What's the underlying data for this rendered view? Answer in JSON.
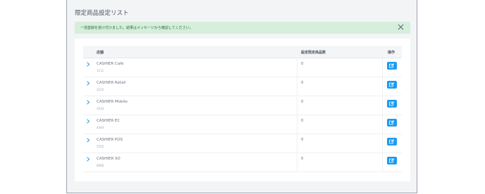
{
  "page": {
    "title": "限定商品設定リスト"
  },
  "alert": {
    "message": "一括登録を受け付けました。結果はメッセージから確認してください。"
  },
  "table": {
    "columns": [
      "店舗",
      "設定限定商品数",
      "操作"
    ],
    "rows": [
      {
        "name": "CASHIER Cafe",
        "code": "1111",
        "count": "0"
      },
      {
        "name": "CASHIER Retail",
        "code": "2222",
        "count": "0"
      },
      {
        "name": "CASHIER Mobile",
        "code": "3333",
        "count": "0"
      },
      {
        "name": "CASHIER EC",
        "code": "4444",
        "count": "0"
      },
      {
        "name": "CASHIER POS",
        "code": "5555",
        "count": "0"
      },
      {
        "name": "CASHIER SO",
        "code": "6666",
        "count": "0"
      }
    ]
  },
  "colors": {
    "accent": "#1d9bf0",
    "alert_bg": "#d6eedc",
    "alert_text": "#2f6b3f",
    "panel_bg": "#f3f4f6"
  }
}
